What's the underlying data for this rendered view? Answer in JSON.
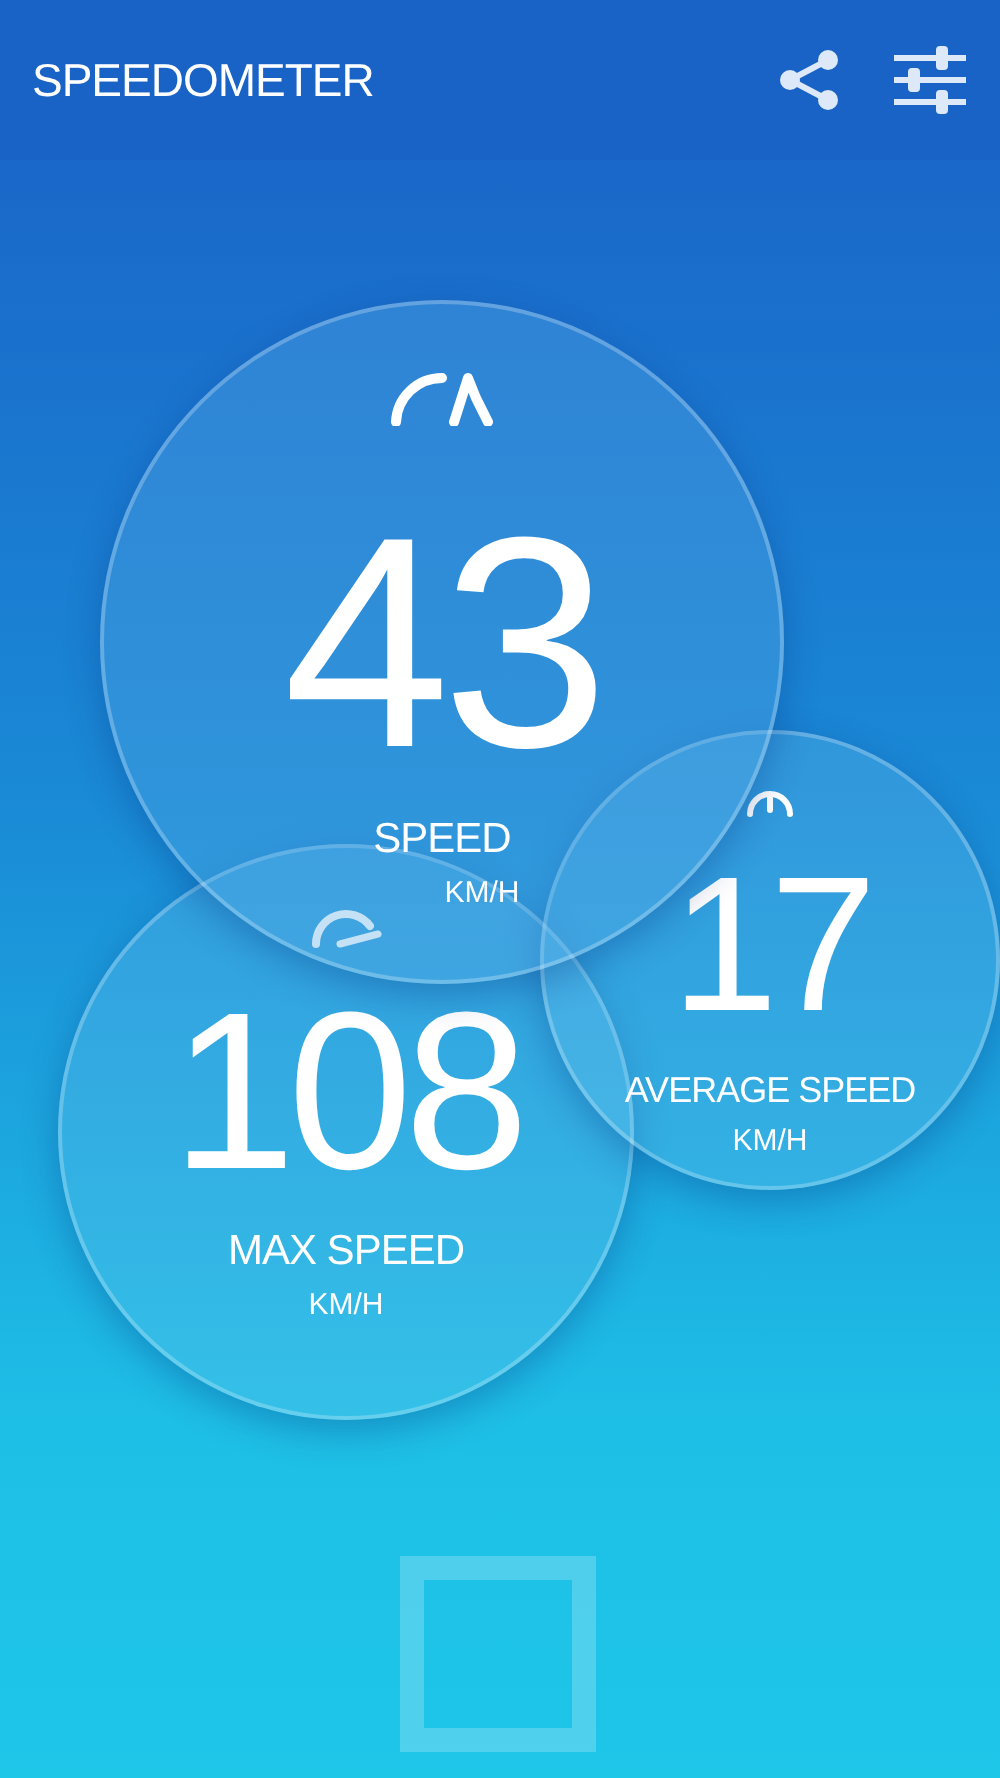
{
  "app_bar": {
    "title": "SPEEDOMETER"
  },
  "gauges": [
    {
      "kind": "main",
      "value": "43",
      "label": "SPEED",
      "unit": "KM/H"
    },
    {
      "kind": "average",
      "value": "17",
      "label": "AVERAGE SPEED",
      "unit": "KM/H"
    },
    {
      "kind": "max",
      "value": "108",
      "label": "MAX SPEED",
      "unit": "KM/H"
    }
  ]
}
